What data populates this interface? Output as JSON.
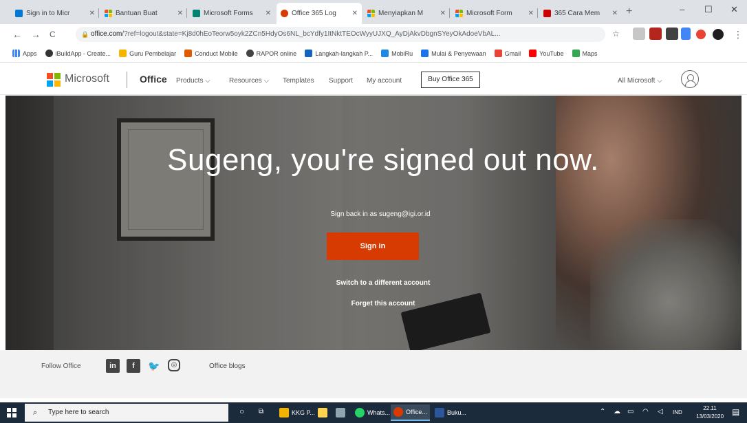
{
  "browser": {
    "tabs": [
      {
        "title": "Sign in to Micr",
        "fav": "#0078d4"
      },
      {
        "title": "Bantuan Buat",
        "fav": "ms"
      },
      {
        "title": "Microsoft Forms",
        "fav": "#008272"
      },
      {
        "title": "Office 365 Log",
        "fav": "#d83b01"
      },
      {
        "title": "Menyiapkan M",
        "fav": "ms"
      },
      {
        "title": "Microsoft Form",
        "fav": "ms"
      },
      {
        "title": "365 Cara Mem",
        "fav": "#cc0000"
      }
    ],
    "new_tab": "+",
    "window_controls": {
      "minimize": "–",
      "maximize": "☐",
      "close": "✕"
    },
    "nav": {
      "back": "←",
      "forward": "→",
      "reload": "C"
    },
    "address": {
      "domain": "office.com",
      "rest": "/?ref=logout&state=Kj8d0hEoTeorw5oyk2ZCn5HdyOs6NL_bcYdfy1ItNktTEOcWyyUJXQ_AyDjAkvDbgnSYeyOkAdoeVbAL..."
    },
    "bookmarks": [
      {
        "label": "Apps",
        "color": "#5f6368"
      },
      {
        "label": "iBuildApp - Create...",
        "color": "#333"
      },
      {
        "label": "Guru Pembelajar",
        "color": "#f4b400"
      },
      {
        "label": "Conduct Mobile",
        "color": "#e25a00"
      },
      {
        "label": "RAPOR online",
        "color": "#444"
      },
      {
        "label": "Langkah-langkah P...",
        "color": "#1565c0"
      },
      {
        "label": "MobiRu",
        "color": "#1e88e5"
      },
      {
        "label": "Mulai & Penyewaan",
        "color": "#1a73e8"
      },
      {
        "label": "Gmail",
        "color": "#ea4335"
      },
      {
        "label": "YouTube",
        "color": "#ff0000"
      },
      {
        "label": "Maps",
        "color": "#34a853"
      }
    ]
  },
  "header": {
    "brand": "Microsoft",
    "product": "Office",
    "nav": [
      {
        "label": "Products ⌵"
      },
      {
        "label": "Resources ⌵"
      },
      {
        "label": "Templates"
      },
      {
        "label": "Support"
      },
      {
        "label": "My account"
      }
    ],
    "buy_button": "Buy Office 365",
    "all_microsoft": "All Microsoft ⌵"
  },
  "hero": {
    "title": "Sugeng, you're signed out now.",
    "subtitle": "Sign back in as sugeng@igi.or.id",
    "sign_in": "Sign in",
    "switch_account": "Switch to a different account",
    "forget_account": "Forget this account"
  },
  "footer": {
    "follow": "Follow Office",
    "social": [
      "in",
      "f",
      "🐦",
      "◎"
    ],
    "blogs": "Office blogs"
  },
  "taskbar": {
    "search_placeholder": "Type here to search",
    "apps": [
      {
        "label": "KKG P...",
        "color": "#f4b400"
      },
      {
        "label": "",
        "color": "#ffd54f"
      },
      {
        "label": "",
        "color": "#90a4ae"
      },
      {
        "label": "Whats...",
        "color": "#25d366"
      },
      {
        "label": "Office...",
        "color": "#d83b01"
      },
      {
        "label": "Buku...",
        "color": "#2b579a"
      }
    ],
    "tray_lang": "IND",
    "time": "22.11",
    "date": "13/03/2020"
  },
  "colors": {
    "accent": "#d83b01",
    "taskbar": "#1c2b3c"
  }
}
